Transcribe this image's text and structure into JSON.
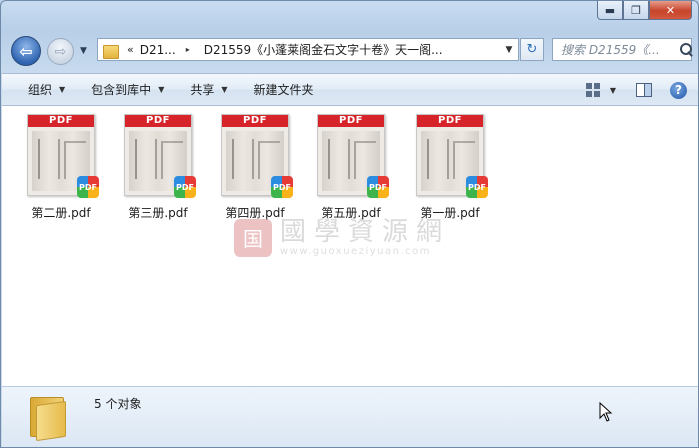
{
  "window": {
    "caption_minimize": "▬",
    "caption_maximize": "❐",
    "caption_close": "✕"
  },
  "nav": {
    "back_glyph": "⇦",
    "forward_glyph": "⇨",
    "history_glyph": "▼",
    "breadcrumb_lead": "«",
    "breadcrumb_short": "D21...",
    "breadcrumb_arrow": "▸",
    "path": "D21559《小蓬莱阁金石文字十卷》天一阁...",
    "address_dropdown": "▼",
    "refresh_glyph": "↻",
    "search_placeholder": "搜索 D21559《..."
  },
  "toolbar": {
    "organize": "组织",
    "include_library": "包含到库中",
    "share": "共享",
    "new_folder": "新建文件夹",
    "dropdown_glyph": "▼",
    "help_glyph": "?"
  },
  "files": [
    {
      "name": "第二册.pdf",
      "banner": "PDF",
      "badge": "PDF"
    },
    {
      "name": "第三册.pdf",
      "banner": "PDF",
      "badge": "PDF"
    },
    {
      "name": "第四册.pdf",
      "banner": "PDF",
      "badge": "PDF"
    },
    {
      "name": "第五册.pdf",
      "banner": "PDF",
      "badge": "PDF"
    },
    {
      "name": "第一册.pdf",
      "banner": "PDF",
      "badge": "PDF"
    }
  ],
  "watermark": {
    "seal": "国",
    "chinese": "國學資源網",
    "url": "www.guoxueziyuan.com"
  },
  "details": {
    "item_count": "5 个对象"
  },
  "colors": {
    "pdf_banner": "#d6242a",
    "accent_blue": "#2f64b1"
  }
}
